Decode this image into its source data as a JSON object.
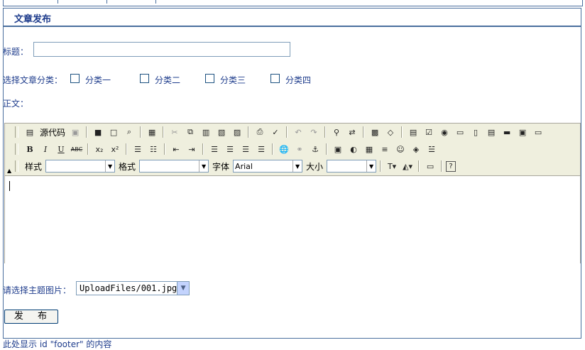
{
  "section": {
    "title": "文章发布"
  },
  "form": {
    "title_label": "标题：",
    "title_value": "",
    "category_label": "选择文章分类：",
    "categories": [
      "分类一",
      "分类二",
      "分类三",
      "分类四"
    ],
    "body_label": "正文：",
    "image_label": "请选择主题图片：",
    "image_value": "UploadFiles/001.jpg",
    "submit_label": "发 布"
  },
  "editor": {
    "source_label": "源代码",
    "style_label": "样式",
    "format_label": "格式",
    "font_label": "字体",
    "font_value": "Arial",
    "size_label": "大小",
    "bold_glyph": "B",
    "italic_glyph": "I",
    "underline_glyph": "U",
    "strike_glyph": "ABC",
    "sub_glyph": "x₂",
    "sup_glyph": "x²",
    "help_glyph": "?"
  },
  "footer": {
    "text": "此处显示 id \"footer\" 的内容"
  }
}
